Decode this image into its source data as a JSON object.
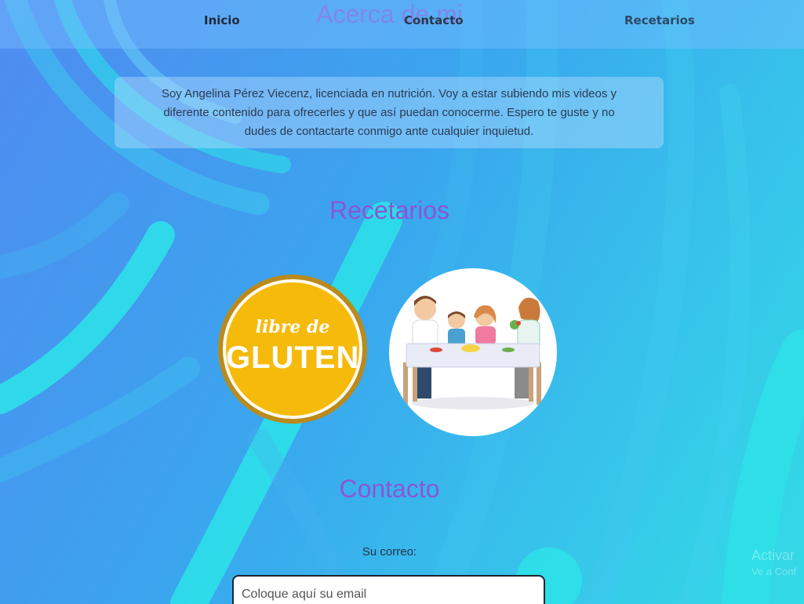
{
  "nav": {
    "items": [
      {
        "label": "Inicio"
      },
      {
        "label": "Contacto"
      },
      {
        "label": "Recetarios"
      }
    ]
  },
  "about": {
    "title": "Acerca de mi",
    "text": "Soy Angelina Pérez Viecenz, licenciada en nutrición. Voy a estar subiendo mis videos y diferente contenido para ofrecerles y que así puedan conocerme. Espero te guste y no dudes de contactarte conmigo ante cualquier inquietud."
  },
  "recetarios": {
    "title": "Recetarios",
    "cards": [
      {
        "name": "gluten-free",
        "badge_top": "libre de",
        "badge_main": "GLUTEN",
        "colors": {
          "fill": "#f6ba0b",
          "rim": "#b98a1c"
        }
      },
      {
        "name": "family-meal",
        "icon": "family-dinner-illustration"
      }
    ]
  },
  "contacto": {
    "title": "Contacto",
    "email_label": "Su correo:",
    "email_placeholder": "Coloque aquí su email",
    "email_value": ""
  },
  "watermark": {
    "line1": "Activar",
    "line2": "Ve a Conf"
  },
  "colors": {
    "title": "#8a56d6",
    "bg_start": "#4f8bf0",
    "bg_end": "#33dbe6"
  }
}
